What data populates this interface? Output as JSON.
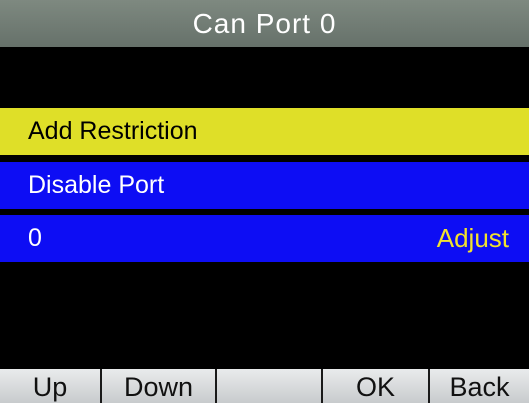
{
  "header": {
    "title": "Can Port 0"
  },
  "menu": {
    "items": [
      {
        "label": "Add Restriction"
      },
      {
        "label": "Disable Port"
      }
    ],
    "value_row": {
      "value": "0",
      "action": "Adjust"
    }
  },
  "softkeys": [
    {
      "label": "Up"
    },
    {
      "label": "Down"
    },
    {
      "label": ""
    },
    {
      "label": "OK"
    },
    {
      "label": "Back"
    }
  ],
  "colors": {
    "selected_highlight": "#dfdf28",
    "item_background": "#0d0df4",
    "action_text": "#f2e22e",
    "title_bar": "#737e77"
  }
}
